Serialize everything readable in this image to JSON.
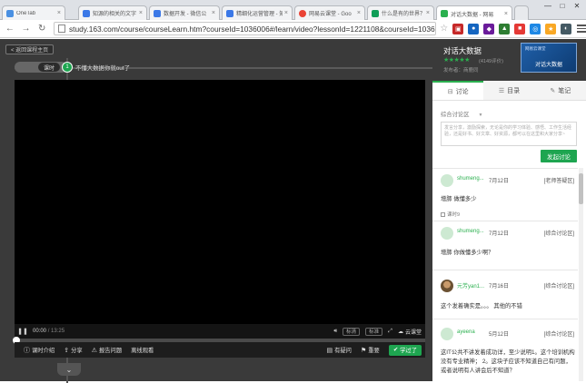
{
  "browser": {
    "tabs": [
      {
        "label": "OneTab",
        "color": "#4a90e2",
        "active": false
      },
      {
        "label": "知源的相关的文字",
        "color": "#3b78e7",
        "active": false
      },
      {
        "label": "数据开发 - 微信公",
        "color": "#3b78e7",
        "active": false
      },
      {
        "label": "精细化运营管理 - 知",
        "color": "#3b78e7",
        "active": false
      },
      {
        "label": "网易云课堂 - Goo",
        "color": "#ea4335",
        "active": false
      },
      {
        "label": "什么是有的世界？",
        "color": "#0f9d58",
        "active": false
      },
      {
        "label": "对话大数据 - 网易",
        "color": "#2bb04f",
        "active": true
      }
    ],
    "url": "study.163.com/course/courseLearn.htm?courseId=1036006#/learn/video?lessonId=1221108&courseId=1036006",
    "window_controls": [
      "—",
      "□",
      "✕"
    ]
  },
  "player": {
    "back_label": "< 返回课程主页",
    "lesson_pill": "课时",
    "lesson_number": "1",
    "lesson_title": "不懂大数据你就out了",
    "time_current": "00:00",
    "time_total": "/ 13:25",
    "chip_a": "标清",
    "chip_b": "标准",
    "cloud_label": "云课堂",
    "bottom": {
      "intro": "课时介绍",
      "share": "分享",
      "report": "报告问题",
      "offline": "离线观看",
      "ask": "有疑问",
      "key": "重要",
      "learned": "学过了"
    }
  },
  "sidebar": {
    "course_title": "对话大数据",
    "stars": "★★★★★",
    "rating_text": "(4149评价)",
    "publisher": "发布者：商鹿同",
    "thumb_top": "网易云课堂",
    "thumb_label": "对话大数据",
    "tabs": {
      "discuss": "讨论",
      "catalog": "目录",
      "notes": "笔记"
    },
    "filter_label": "综合讨论区",
    "textarea_placeholder": "发言分享，激励探索，无论是你的学习体验、感悟、工作生活经验，还是好书、好文章、好资源，都可以在这里和大家分享~",
    "submit_label": "发起讨论",
    "posts": [
      {
        "author": "shumeng...",
        "date": "7月12日",
        "forum": "[老师答疑区]",
        "content": "增肺  做懂多少",
        "meta": "课时9"
      },
      {
        "author": "shumeng...",
        "date": "7月12日",
        "forum": "[综合讨论区]",
        "content": "增肺  你做懂多少啊？",
        "meta": ""
      },
      {
        "author": "元芳yan1...",
        "date": "7月16日",
        "forum": "[综合讨论区]",
        "content": "这个发着确实是。。。 其他的不错",
        "meta": ""
      },
      {
        "author": "ayeena",
        "date": "5月12日",
        "forum": "[综合讨论区]",
        "content": "这IT公共不讲发着成功详，至少说明1。这个培训机构没有专业精神； 2。这块子应该不知道自己有问题，或者说明有人讲会后不知道？",
        "meta": ""
      }
    ]
  }
}
